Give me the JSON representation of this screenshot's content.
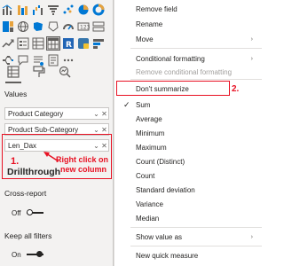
{
  "panel": {
    "values_heading": "Values",
    "wells": [
      {
        "label": "Product Category"
      },
      {
        "label": "Product Sub-Category"
      },
      {
        "label": "Len_Dax"
      }
    ],
    "drillthrough_label": "Drillthrough",
    "cross_report": {
      "label": "Cross-report",
      "state": "Off"
    },
    "keep_all_filters": {
      "label": "Keep all filters",
      "state": "On"
    }
  },
  "annotations": {
    "step1": "1.",
    "step1_text_line1": "Right click on",
    "step1_text_line2": "new column",
    "step2": "2.",
    "color": "#e81123"
  },
  "menu": {
    "items": [
      {
        "label": "Remove field",
        "submenu": false,
        "disabled": false,
        "checked": false
      },
      {
        "label": "Rename",
        "submenu": false,
        "disabled": false,
        "checked": false
      },
      {
        "label": "Move",
        "submenu": true,
        "disabled": false,
        "checked": false
      },
      {
        "label": "Conditional formatting",
        "submenu": true,
        "disabled": false,
        "checked": false
      },
      {
        "label": "Remove conditional formatting",
        "submenu": false,
        "disabled": true,
        "checked": false
      },
      {
        "label": "Don't summarize",
        "submenu": false,
        "disabled": false,
        "checked": false
      },
      {
        "label": "Sum",
        "submenu": false,
        "disabled": false,
        "checked": true
      },
      {
        "label": "Average",
        "submenu": false,
        "disabled": false,
        "checked": false
      },
      {
        "label": "Minimum",
        "submenu": false,
        "disabled": false,
        "checked": false
      },
      {
        "label": "Maximum",
        "submenu": false,
        "disabled": false,
        "checked": false
      },
      {
        "label": "Count (Distinct)",
        "submenu": false,
        "disabled": false,
        "checked": false
      },
      {
        "label": "Count",
        "submenu": false,
        "disabled": false,
        "checked": false
      },
      {
        "label": "Standard deviation",
        "submenu": false,
        "disabled": false,
        "checked": false
      },
      {
        "label": "Variance",
        "submenu": false,
        "disabled": false,
        "checked": false
      },
      {
        "label": "Median",
        "submenu": false,
        "disabled": false,
        "checked": false
      },
      {
        "label": "Show value as",
        "submenu": true,
        "disabled": false,
        "checked": false
      },
      {
        "label": "New quick measure",
        "submenu": false,
        "disabled": false,
        "checked": false
      }
    ],
    "check_glyph": "✓",
    "submenu_glyph": "›"
  },
  "icons": {
    "well_chevron": "⌄",
    "well_close": "✕"
  }
}
